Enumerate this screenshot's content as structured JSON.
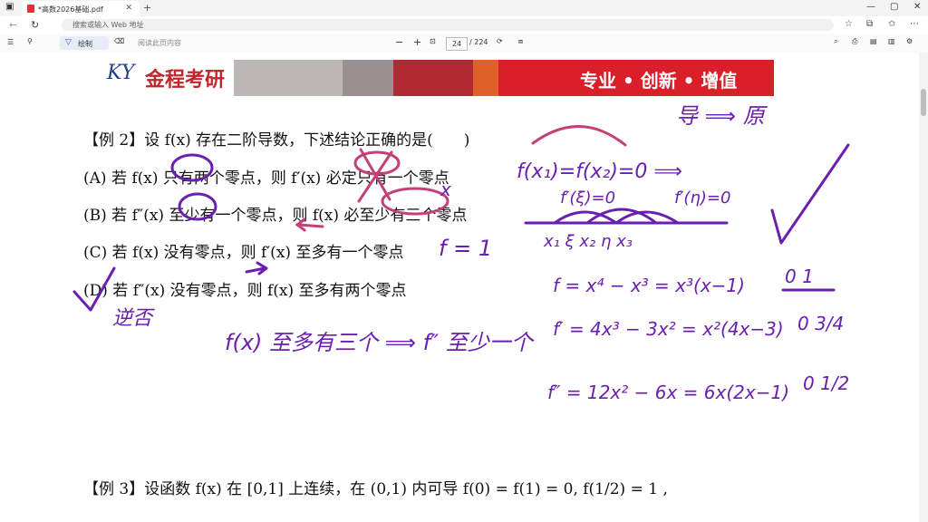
{
  "tab": {
    "title": "*高数2026基础.pdf"
  },
  "address": {
    "placeholder": "搜索或输入 Web 地址"
  },
  "toolbar": {
    "draw_label": "绘制",
    "search_hint": "阅读此页内容",
    "page_current": "24",
    "page_total": "/ 224"
  },
  "banner": {
    "logo": "KY",
    "brand": "金程考研",
    "slogan": "专业 • 创新 • 增值"
  },
  "example2": {
    "title": "【例 2】设 f(x) 存在二阶导数，下述结论正确的是(　　)",
    "A": "(A) 若 f(x) 只有两个零点，则 f′(x) 必定只有一个零点",
    "B": "(B) 若 f″(x) 至少有一个零点，则 f(x) 必至少有三个零点",
    "C": "(C) 若 f(x) 没有零点，则 f′(x) 至多有一个零点",
    "D": "(D) 若 f″(x) 没有零点，则 f(x) 至多有两个零点"
  },
  "example3": {
    "text": "【例 3】设函数 f(x) 在 [0,1] 上连续，在 (0,1) 内可导 f(0) = f(1) = 0, f(1/2) = 1 ,"
  },
  "handwriting": {
    "h1": "导 ⟹ 原",
    "h2": "f(x₁)=f(x₂)=0 ⟹",
    "h3": "f′(ξ)=0",
    "h4": "f′(η)=0",
    "h5": "x₁  ξ  x₂  η  x₃",
    "h6": "f = 1",
    "h7": "f = x⁴ − x³ = x³(x−1)",
    "h8": "f′ = 4x³ − 3x² = x²(4x−3)",
    "h9": "f″ = 12x² − 6x = 6x(2x−1)",
    "h10": "0  1",
    "h11": "0  3/4",
    "h12": "0  1/2",
    "h13": "f(x) 至多有三个 ⟹ f″ 至少一个",
    "h14": "逆否",
    "h15": "x"
  }
}
